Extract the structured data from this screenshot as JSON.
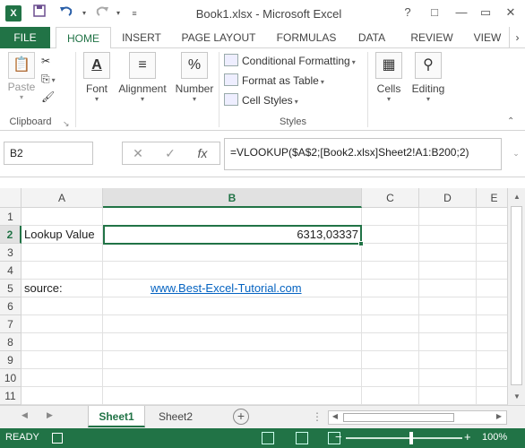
{
  "window": {
    "title": "Book1.xlsx - Microsoft Excel",
    "app_icon": "X",
    "controls": [
      "?",
      "□",
      "—",
      "▭",
      "✕"
    ]
  },
  "quick_access": [
    "save-icon",
    "undo-icon",
    "redo-icon",
    "customize-icon"
  ],
  "ribbon": {
    "tabs": [
      "FILE",
      "HOME",
      "INSERT",
      "PAGE LAYOUT",
      "FORMULAS",
      "DATA",
      "REVIEW",
      "VIEW"
    ],
    "active_tab": "HOME",
    "clipboard": {
      "paste": "Paste",
      "label": "Clipboard"
    },
    "font": {
      "label": "Font"
    },
    "alignment": {
      "label": "Alignment"
    },
    "number": {
      "label": "Number"
    },
    "styles": {
      "conditional": "Conditional Formatting",
      "format_table": "Format as Table",
      "cell_styles": "Cell Styles",
      "label": "Styles"
    },
    "cells": {
      "label": "Cells"
    },
    "editing": {
      "label": "Editing"
    }
  },
  "formula_bar": {
    "name_box": "B2",
    "formula": "=VLOOKUP($A$2;[Book2.xlsx]Sheet2!A1:B200;2)"
  },
  "grid": {
    "columns": [
      "A",
      "B",
      "C",
      "D",
      "E"
    ],
    "selected_column": "B",
    "rows": [
      "1",
      "2",
      "3",
      "4",
      "5",
      "6",
      "7",
      "8",
      "9",
      "10",
      "11"
    ],
    "selected_row": "2",
    "cells": {
      "A2": "Lookup Value",
      "B2": "6313,03337",
      "A5": "source:",
      "B5": "www.Best-Excel-Tutorial.com"
    }
  },
  "sheets": {
    "tabs": [
      "Sheet1",
      "Sheet2"
    ],
    "active": "Sheet1"
  },
  "status": {
    "text": "READY",
    "zoom": "100%",
    "zoom_minus": "−",
    "zoom_plus": "+"
  },
  "colors": {
    "excel_green": "#217346",
    "link_blue": "#0563c1"
  }
}
